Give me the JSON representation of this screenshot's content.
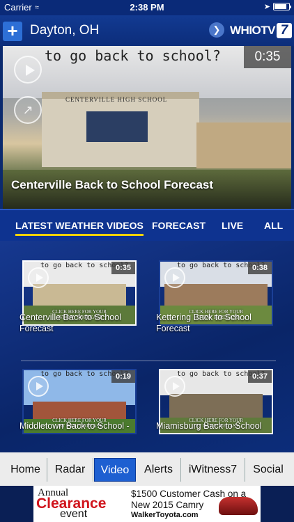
{
  "status_bar": {
    "carrier": "Carrier",
    "time": "2:38 PM"
  },
  "nav": {
    "city": "Dayton, OH",
    "logo_text": "WHIOTV",
    "logo_number": "7"
  },
  "hero": {
    "scribble": "to go back to school?",
    "sign": "CENTERVILLE HIGH SCHOOL",
    "duration": "0:35",
    "caption": "Centerville Back to School Forecast"
  },
  "tabs": [
    {
      "label": "LATEST WEATHER VIDEOS"
    },
    {
      "label": "FORECAST"
    },
    {
      "label": "LIVE"
    },
    {
      "label": "ALL"
    }
  ],
  "videos": [
    {
      "title": "Centerville Back to School Forecast",
      "duration": "0:35",
      "scribble": "to go back to school?",
      "overlay": "CLICK HERE FOR YOUR\n1ST DAY FORECAST"
    },
    {
      "title": "Kettering Back to School Forecast",
      "duration": "0:38",
      "scribble": "to go back to school?",
      "overlay": "CLICK HERE FOR YOUR\n1ST DAY FORECAST"
    },
    {
      "title": "Middletown Back to School -",
      "duration": "0:19",
      "scribble": "to go back to school?",
      "overlay": "CLICK HERE FOR YOUR\n1ST DAY FORECAST"
    },
    {
      "title": "Miamisburg Back to School",
      "duration": "0:37",
      "scribble": "to go back to school?",
      "overlay": "CLICK HERE FOR YOUR\n1ST DAY FORECAST"
    }
  ],
  "bottom_tabs": [
    {
      "label": "Home"
    },
    {
      "label": "Radar"
    },
    {
      "label": "Video"
    },
    {
      "label": "Alerts"
    },
    {
      "label": "iWitness7"
    },
    {
      "label": "Social"
    }
  ],
  "ad": {
    "annual": "Annual",
    "clearance": "Clearance",
    "event": "event",
    "offer": "$1500 Customer Cash on a New 2015 Camry",
    "dealer": "WalkerToyota.com"
  },
  "colors": {
    "accent": "#1d5fd1",
    "tab_underline": "#f2d200",
    "navbar": "#0c2d7a"
  }
}
